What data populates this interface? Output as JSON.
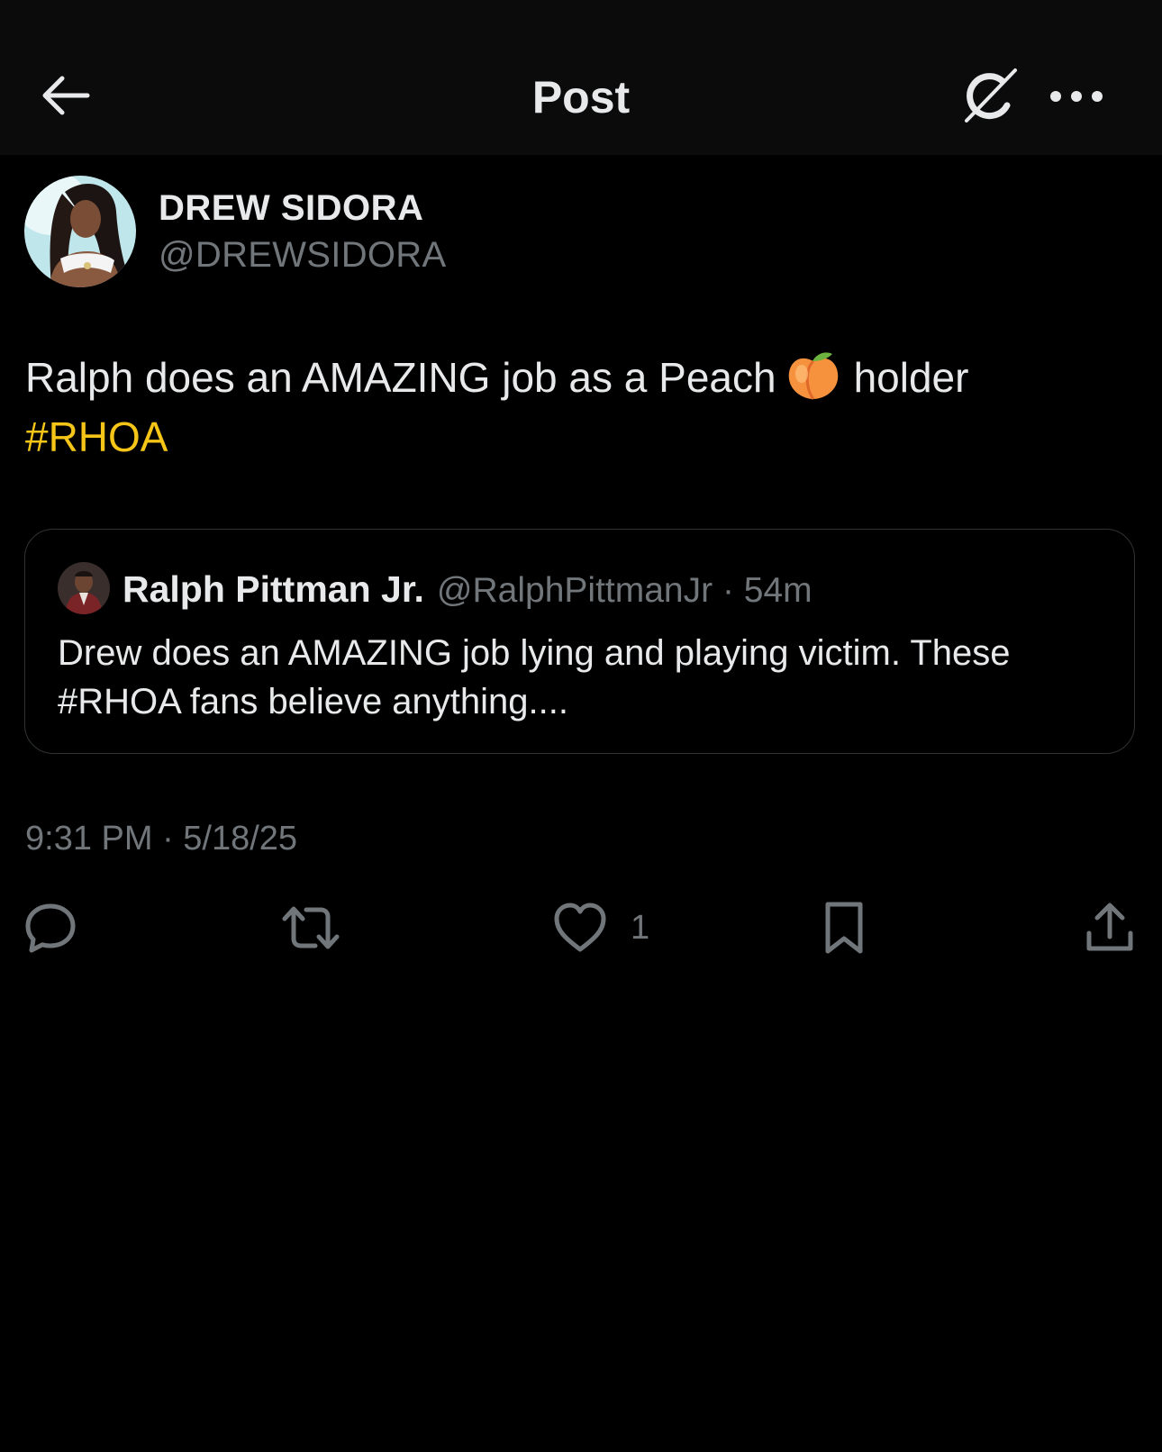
{
  "header": {
    "title": "Post",
    "back_icon": "arrow-left-icon",
    "grok_icon": "grok-icon",
    "more_icon": "more-horizontal-icon"
  },
  "post": {
    "author": {
      "display_name": "DREW SIDORA",
      "handle": "@DREWSIDORA"
    },
    "text_before_emoji": "Ralph does an AMAZING job as a Peach",
    "emoji": "peach-emoji",
    "text_after_emoji": "holder",
    "hashtag": "#RHOA",
    "timestamp": "9:31 PM · 5/18/25"
  },
  "quoted_post": {
    "display_name": "Ralph Pittman Jr.",
    "meta": "@RalphPittmanJr · 54m",
    "text": "Drew does an AMAZING job lying and playing victim. These #RHOA fans believe anything...."
  },
  "actions": {
    "reply_icon": "reply-icon",
    "repost_icon": "repost-icon",
    "like_icon": "heart-icon",
    "like_count": "1",
    "bookmark_icon": "bookmark-icon",
    "share_icon": "share-icon"
  },
  "colors": {
    "background": "#000000",
    "header_background": "#0b0b0b",
    "text_primary": "#e7e9ea",
    "text_secondary": "#71767b",
    "hashtag": "#f5c518",
    "border": "#2f3336"
  }
}
